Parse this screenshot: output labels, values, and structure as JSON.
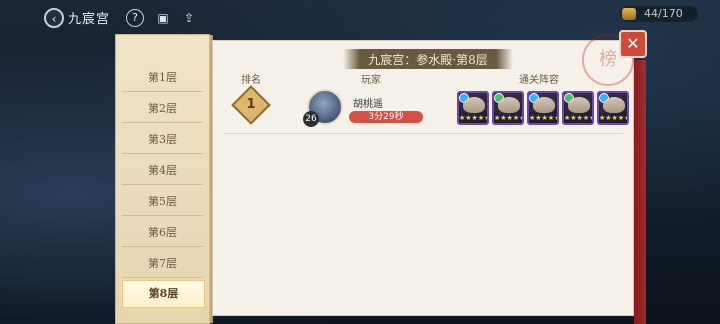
{
  "topbar": {
    "title": "九宸宫",
    "back_icon": "back-arrow-icon",
    "help_label": "?",
    "resource_text": "44/170",
    "resource_icon": "gold-chest-icon"
  },
  "floors": {
    "items": [
      "第1层",
      "第2层",
      "第3层",
      "第4层",
      "第5层",
      "第6层",
      "第7层",
      "第8层"
    ],
    "selected": "第8层"
  },
  "board": {
    "title": "九宸宫：参水殿·第8层",
    "columns": {
      "rank": "排名",
      "player": "玩家",
      "team": "通关阵容"
    },
    "rows": [
      {
        "rank": "1",
        "level": "26",
        "name": "胡桃遥",
        "time": "3分29秒",
        "heroes": [
          {
            "icon": "hero-portrait-1",
            "stars": "★★★★★"
          },
          {
            "icon": "hero-portrait-2",
            "stars": "★★★★★"
          },
          {
            "icon": "hero-portrait-3",
            "stars": "★★★★★"
          },
          {
            "icon": "hero-portrait-4",
            "stars": "★★★★★"
          },
          {
            "icon": "hero-portrait-5",
            "stars": "★★★★★"
          }
        ]
      }
    ],
    "stamp_text": "榜",
    "close_icon": "close-x-icon"
  },
  "colors": {
    "accent_red": "#d04a39",
    "paper": "#f6f1e8",
    "gold": "#dcb86f"
  }
}
